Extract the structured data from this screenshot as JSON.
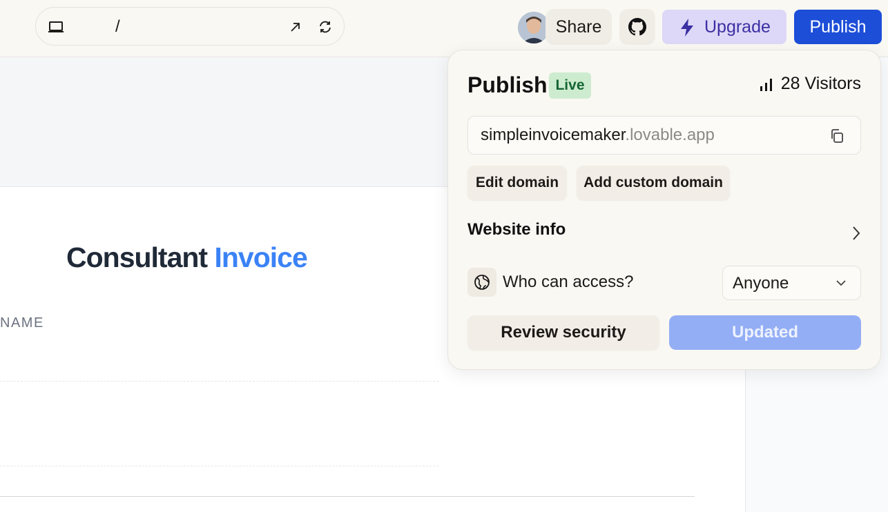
{
  "topbar": {
    "path": "/",
    "icons": {
      "device": "laptop-icon",
      "open_external": "arrow-up-right-icon",
      "refresh": "refresh-icon",
      "github": "github-icon",
      "upgrade": "lightning-icon"
    },
    "share_label": "Share",
    "upgrade_label": "Upgrade",
    "publish_label": "Publish"
  },
  "preview": {
    "title_main": "Consultant",
    "title_accent": "Invoice",
    "field_label": "NAME"
  },
  "publish_panel": {
    "title": "Publish",
    "status_badge": "Live",
    "visitors_label": "28 Visitors",
    "domain_sub": "simpleinvoicemaker",
    "domain_suffix": ".lovable.app",
    "edit_domain_label": "Edit domain",
    "custom_domain_label": "Add custom domain",
    "website_info_label": "Website info",
    "access_label": "Who can access?",
    "access_value": "Anyone",
    "review_security_label": "Review security",
    "updated_label": "Updated"
  },
  "colors": {
    "primary": "#1d4ed8",
    "upgrade_bg": "#ddd8f7",
    "live_badge_bg": "#cdeccf",
    "title_accent": "#3b82f6",
    "updated_bg": "#93aef5"
  }
}
